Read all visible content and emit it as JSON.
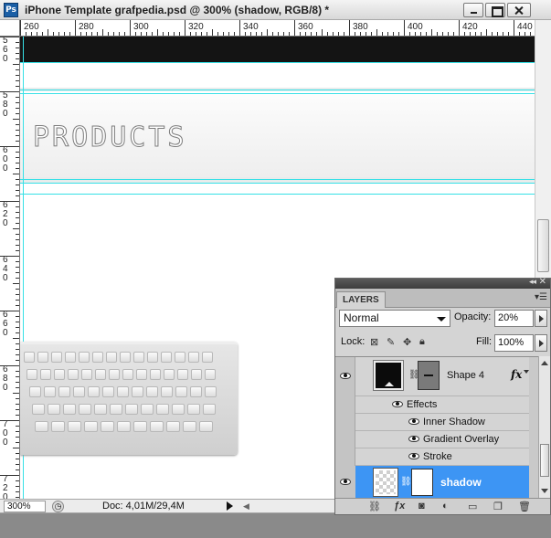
{
  "window": {
    "app_icon": "Ps",
    "title": "iPhone Template grafpedia.psd @ 300% (shadow, RGB/8) *"
  },
  "ruler_h": [
    "260",
    "280",
    "300",
    "320",
    "340",
    "360",
    "380",
    "400",
    "420",
    "440"
  ],
  "ruler_v": [
    "560",
    "580",
    "600",
    "620",
    "640",
    "660",
    "680",
    "700",
    "720"
  ],
  "canvas": {
    "heading": "PRODUCTS"
  },
  "status": {
    "zoom": "300%",
    "doc": "Doc: 4,01M/29,4M"
  },
  "layers_panel": {
    "tab": "LAYERS",
    "blend_mode": "Normal",
    "opacity_label": "Opacity:",
    "opacity_value": "20%",
    "lock_label": "Lock:",
    "fill_label": "Fill:",
    "fill_value": "100%",
    "layers": [
      {
        "name": "Shape 4",
        "fx": "fx"
      },
      {
        "name": "shadow"
      }
    ],
    "effects_label": "Effects",
    "effects": [
      "Inner Shadow",
      "Gradient Overlay",
      "Stroke"
    ]
  },
  "colors": {
    "selection": "#3d95f4",
    "guide": "#36e0e6"
  }
}
